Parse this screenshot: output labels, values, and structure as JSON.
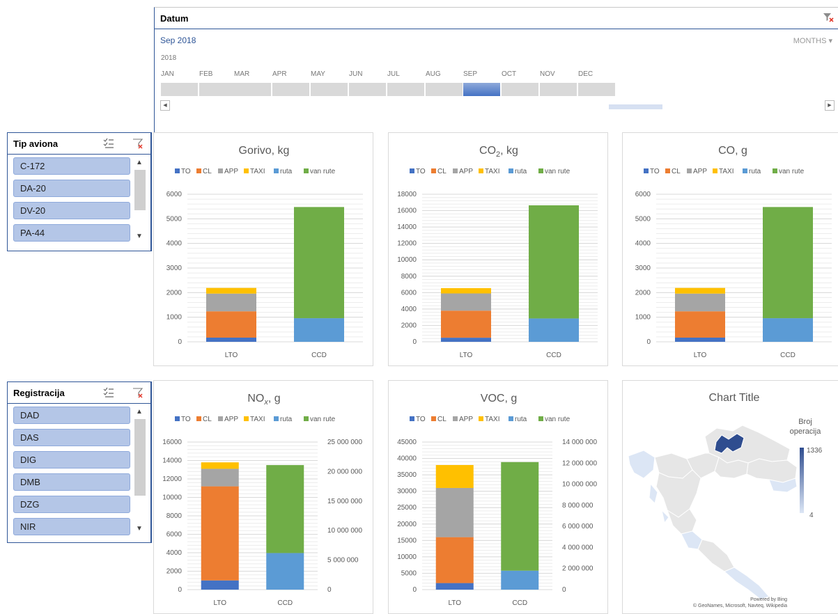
{
  "timeline": {
    "header": "Datum",
    "selected": "Sep 2018",
    "level": "MONTHS ▾",
    "year": "2018",
    "months": [
      "JAN",
      "FEB",
      "MAR",
      "APR",
      "MAY",
      "JUN",
      "JUL",
      "AUG",
      "SEP",
      "OCT",
      "NOV",
      "DEC"
    ],
    "selected_month": "SEP"
  },
  "slicer_tip": {
    "title": "Tip aviona",
    "items": [
      "C-172",
      "DA-20",
      "DV-20",
      "PA-44"
    ]
  },
  "slicer_reg": {
    "title": "Registracija",
    "items": [
      "DAD",
      "DAS",
      "DIG",
      "DMB",
      "DZG",
      "NIR"
    ]
  },
  "legend": [
    {
      "name": "TO",
      "color": "#4472c4"
    },
    {
      "name": "CL",
      "color": "#ed7d31"
    },
    {
      "name": "APP",
      "color": "#a5a5a5"
    },
    {
      "name": "TAXI",
      "color": "#ffc000"
    },
    {
      "name": "ruta",
      "color": "#5b9bd5"
    },
    {
      "name": "van rute",
      "color": "#70ad47"
    }
  ],
  "map": {
    "title": "Chart Title",
    "legend_title_1": "Broj",
    "legend_title_2": "operacija",
    "max_label": "1336",
    "min_label": "4",
    "credit_1": "Powered by Bing",
    "credit_2": "© GeoNames, Microsoft, Navteq, Wikipedia",
    "color_high": "#2f4d8f",
    "color_low": "#dce6f5"
  },
  "chart_data": [
    {
      "type": "bar",
      "stacked": true,
      "title": "Gorivo, kg",
      "categories": [
        "LTO",
        "CCD"
      ],
      "ylim": [
        0,
        6000
      ],
      "yticks": [
        0,
        1000,
        2000,
        3000,
        4000,
        5000,
        6000
      ],
      "series": [
        {
          "name": "TO",
          "values": [
            170,
            0
          ]
        },
        {
          "name": "CL",
          "values": [
            1070,
            0
          ]
        },
        {
          "name": "APP",
          "values": [
            720,
            0
          ]
        },
        {
          "name": "TAXI",
          "values": [
            230,
            0
          ]
        },
        {
          "name": "ruta",
          "values": [
            0,
            960
          ]
        },
        {
          "name": "van rute",
          "values": [
            0,
            4520
          ]
        }
      ]
    },
    {
      "type": "bar",
      "stacked": true,
      "title": "CO2, kg",
      "categories": [
        "LTO",
        "CCD"
      ],
      "ylim": [
        0,
        18000
      ],
      "yticks": [
        0,
        2000,
        4000,
        6000,
        8000,
        10000,
        12000,
        14000,
        16000,
        18000
      ],
      "series": [
        {
          "name": "TO",
          "values": [
            500,
            0
          ]
        },
        {
          "name": "CL",
          "values": [
            3300,
            0
          ]
        },
        {
          "name": "APP",
          "values": [
            2100,
            0
          ]
        },
        {
          "name": "TAXI",
          "values": [
            650,
            0
          ]
        },
        {
          "name": "ruta",
          "values": [
            0,
            2850
          ]
        },
        {
          "name": "van rute",
          "values": [
            0,
            13800
          ]
        }
      ]
    },
    {
      "type": "bar",
      "stacked": true,
      "title": "CO, g",
      "categories": [
        "LTO",
        "CCD"
      ],
      "ylim": [
        0,
        6000
      ],
      "yticks": [
        0,
        1000,
        2000,
        3000,
        4000,
        5000,
        6000
      ],
      "series": [
        {
          "name": "TO",
          "values": [
            170,
            0
          ]
        },
        {
          "name": "CL",
          "values": [
            1070,
            0
          ]
        },
        {
          "name": "APP",
          "values": [
            720,
            0
          ]
        },
        {
          "name": "TAXI",
          "values": [
            230,
            0
          ]
        },
        {
          "name": "ruta",
          "values": [
            0,
            960
          ]
        },
        {
          "name": "van rute",
          "values": [
            0,
            4520
          ]
        }
      ]
    },
    {
      "type": "bar",
      "stacked": true,
      "title": "NOx, g",
      "categories": [
        "LTO",
        "CCD"
      ],
      "ylim": [
        0,
        16000
      ],
      "yticks": [
        0,
        2000,
        4000,
        6000,
        8000,
        10000,
        12000,
        14000,
        16000
      ],
      "y2lim": [
        0,
        25000000
      ],
      "y2ticks": [
        0,
        5000000,
        10000000,
        15000000,
        20000000,
        25000000
      ],
      "series": [
        {
          "name": "TO",
          "values": [
            1000,
            0
          ]
        },
        {
          "name": "CL",
          "values": [
            10200,
            0
          ]
        },
        {
          "name": "APP",
          "values": [
            1900,
            0
          ]
        },
        {
          "name": "TAXI",
          "values": [
            700,
            0
          ]
        },
        {
          "name": "ruta",
          "values": [
            0,
            6200000
          ],
          "axis": "secondary"
        },
        {
          "name": "van rute",
          "values": [
            0,
            14900000
          ],
          "axis": "secondary"
        }
      ]
    },
    {
      "type": "bar",
      "stacked": true,
      "title": "VOC, g",
      "categories": [
        "LTO",
        "CCD"
      ],
      "ylim": [
        0,
        45000
      ],
      "yticks": [
        0,
        5000,
        10000,
        15000,
        20000,
        25000,
        30000,
        35000,
        40000,
        45000
      ],
      "y2lim": [
        0,
        14000000
      ],
      "y2ticks": [
        0,
        2000000,
        4000000,
        6000000,
        8000000,
        10000000,
        12000000,
        14000000
      ],
      "series": [
        {
          "name": "TO",
          "values": [
            2000,
            0
          ]
        },
        {
          "name": "CL",
          "values": [
            14000,
            0
          ]
        },
        {
          "name": "APP",
          "values": [
            15000,
            0
          ]
        },
        {
          "name": "TAXI",
          "values": [
            7000,
            0
          ]
        },
        {
          "name": "ruta",
          "values": [
            0,
            1800000
          ],
          "axis": "secondary"
        },
        {
          "name": "van rute",
          "values": [
            0,
            10300000
          ],
          "axis": "secondary"
        }
      ]
    }
  ]
}
